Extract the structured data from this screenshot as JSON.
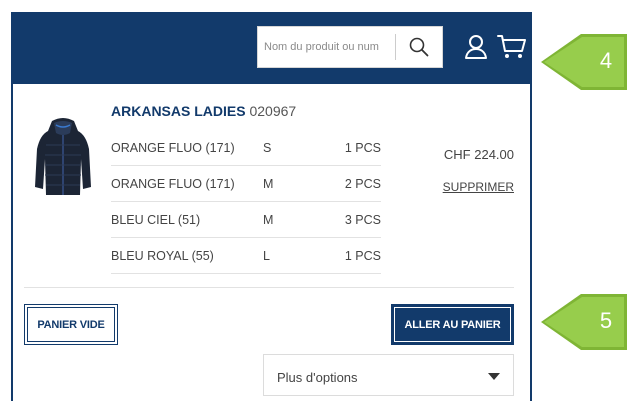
{
  "header": {
    "search": {
      "placeholder": "Nom du produit ou num"
    },
    "icons": {
      "search": "search-icon",
      "user": "user-icon",
      "cart": "cart-icon"
    },
    "color": "#123a6b"
  },
  "cart": {
    "product": {
      "name": "ARKANSAS LADIES",
      "code": "020967",
      "image": "jacket-image",
      "variants": [
        {
          "color": "ORANGE FLUO (171)",
          "size": "S",
          "qty": "1 PCS"
        },
        {
          "color": "ORANGE FLUO (171)",
          "size": "M",
          "qty": "2 PCS"
        },
        {
          "color": "BLEU CIEL (51)",
          "size": "M",
          "qty": "3 PCS"
        },
        {
          "color": "BLEU ROYAL (55)",
          "size": "L",
          "qty": "1 PCS"
        }
      ],
      "price": "CHF 224.00",
      "remove_label": "SUPPRIMER"
    },
    "empty_button": "PANIER VIDE",
    "goto_cart_button": "ALLER AU PANIER",
    "options_select": {
      "selected": "Plus d'options"
    }
  },
  "callouts": [
    {
      "number": "4",
      "color": "#8dc63f"
    },
    {
      "number": "5",
      "color": "#8dc63f"
    }
  ]
}
